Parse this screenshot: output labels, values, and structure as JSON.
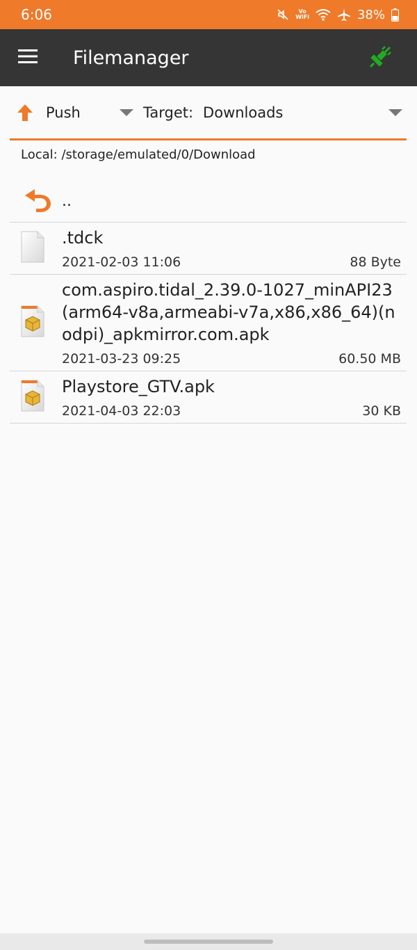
{
  "status": {
    "time": "6:06",
    "vowifi_top": "Vo",
    "vowifi_bottom": "WiFi",
    "battery": "38%",
    "icons": [
      "mute-icon",
      "vowifi-icon",
      "wifi-icon",
      "airplane-icon",
      "battery-icon"
    ]
  },
  "app_bar": {
    "title": "Filemanager",
    "menu_icon": "hamburger-icon",
    "connect_icon": "plug-connected-icon",
    "connect_color": "#22aa22"
  },
  "transfer": {
    "direction": "Push",
    "target_label": "Target:",
    "target_value": "Downloads",
    "accent": "#ee7a2a"
  },
  "local": {
    "path": "Local: /storage/emulated/0/Download"
  },
  "parent": {
    "label": ".."
  },
  "files": [
    {
      "name": ".tdck",
      "date": "2021-02-03 11:06",
      "size": "88 Byte",
      "icon": "file-icon"
    },
    {
      "name": "com.aspiro.tidal_2.39.0-1027_minAPI23(arm64-v8a,armeabi-v7a,x86,x86_64)(nodpi)_apkmirror.com.apk",
      "date": "2021-03-23 09:25",
      "size": "60.50 MB",
      "icon": "apk-package-icon"
    },
    {
      "name": "Playstore_GTV.apk",
      "date": "2021-04-03 22:03",
      "size": "30 KB",
      "icon": "apk-package-icon"
    }
  ]
}
